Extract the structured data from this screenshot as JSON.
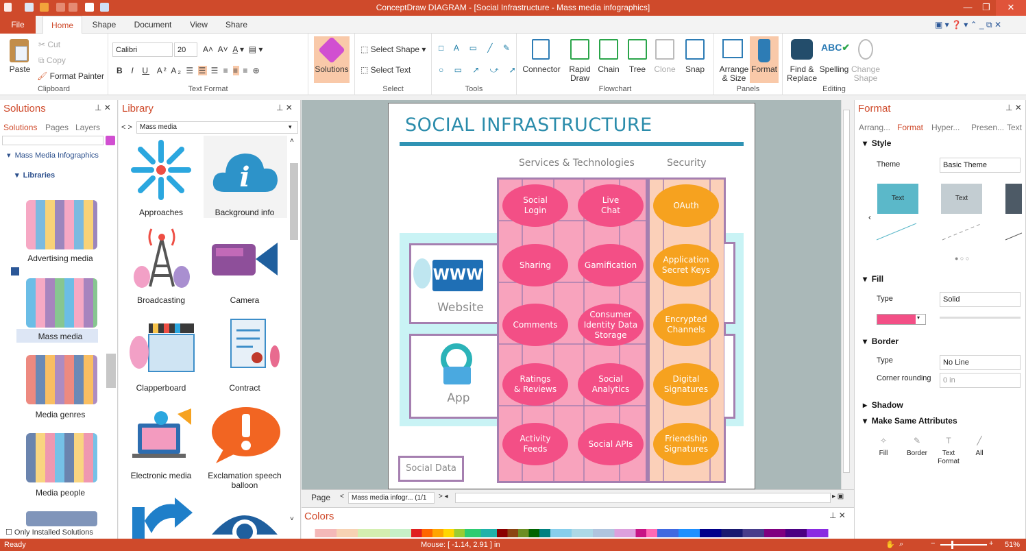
{
  "window": {
    "title": "ConceptDraw DIAGRAM - [Social Infrastructure - Mass media infographics]",
    "min": "—",
    "max": "❐",
    "close": "✕"
  },
  "tabs": [
    {
      "label": "File"
    },
    {
      "label": "Home"
    },
    {
      "label": "Shape"
    },
    {
      "label": "Document"
    },
    {
      "label": "View"
    },
    {
      "label": "Share"
    }
  ],
  "ribbon": {
    "clipboard": {
      "paste": "Paste",
      "cut": "Cut",
      "copy": "Copy",
      "format_painter": "Format Painter",
      "label": "Clipboard"
    },
    "text_format": {
      "font": "Calibri",
      "size": "20",
      "label": "Text Format"
    },
    "solutions": {
      "label": "Solutions"
    },
    "select": {
      "select_shape": "Select Shape",
      "select_text": "Select Text",
      "label": "Select"
    },
    "tools": {
      "label": "Tools"
    },
    "flowchart": {
      "connector": "Connector",
      "rapid_draw": "Rapid\nDraw",
      "chain": "Chain",
      "tree": "Tree",
      "clone": "Clone",
      "snap": "Snap",
      "label": "Flowchart"
    },
    "panels": {
      "arrange": "Arrange\n& Size",
      "format": "Format",
      "label": "Panels"
    },
    "editing": {
      "find": "Find &\nReplace",
      "spelling": "Spelling",
      "change_shape": "Change\nShape",
      "label": "Editing"
    }
  },
  "solutions_panel": {
    "title": "Solutions",
    "tabs": [
      "Solutions",
      "Pages",
      "Layers"
    ],
    "tree_root": "Mass Media Infographics",
    "tree_libraries": "Libraries",
    "items": [
      "Advertising media",
      "Mass media",
      "Media genres",
      "Media people"
    ],
    "only_installed": "Only Installed Solutions"
  },
  "library_panel": {
    "title": "Library",
    "selected": "Mass media",
    "items": [
      "Approaches",
      "Background info",
      "Broadcasting",
      "Camera",
      "Clapperboard",
      "Contract",
      "Electronic media",
      "Exclamation speech balloon"
    ]
  },
  "diagram": {
    "title": "SOCIAL INFRASTRUCTURE",
    "col1": "Services & Technologies",
    "col2": "Security",
    "website": "Website",
    "www": "WWW",
    "app": "App",
    "social_data": "Social Data",
    "pink": [
      "Social\nLogin",
      "Live\nChat",
      "Sharing",
      "Gamification",
      "Comments",
      "Consumer\nIdentity Data\nStorage",
      "Ratings\n& Reviews",
      "Social\nAnalytics",
      "Activity\nFeeds",
      "Social APIs"
    ],
    "orange": [
      "OAuth",
      "Application\nSecret Keys",
      "Encrypted\nChannels",
      "Digital\nSignatures",
      "Friendship\nSignatures"
    ]
  },
  "page_nav": {
    "label": "Page",
    "current": "Mass media infogr... (1/1"
  },
  "colors_panel": {
    "title": "Colors"
  },
  "format_panel": {
    "title": "Format",
    "tabs": [
      "Arrang...",
      "Format",
      "Hyper...",
      "Presen...",
      "Text"
    ],
    "style": "Style",
    "theme_label": "Theme",
    "theme_value": "Basic Theme",
    "sample_text": "Text",
    "fill": "Fill",
    "fill_type_label": "Type",
    "fill_type": "Solid",
    "border": "Border",
    "border_type_label": "Type",
    "border_type": "No Line",
    "corner_label": "Corner rounding",
    "corner_value": "0 in",
    "shadow": "Shadow",
    "make_same": "Make Same Attributes",
    "ms_items": [
      "Fill",
      "Border",
      "Text\nFormat",
      "All"
    ],
    "fill_color": "#f34f86"
  },
  "status": {
    "ready": "Ready",
    "mouse": "Mouse: [ -1.14, 2.91 ] in",
    "zoom": "51%"
  }
}
